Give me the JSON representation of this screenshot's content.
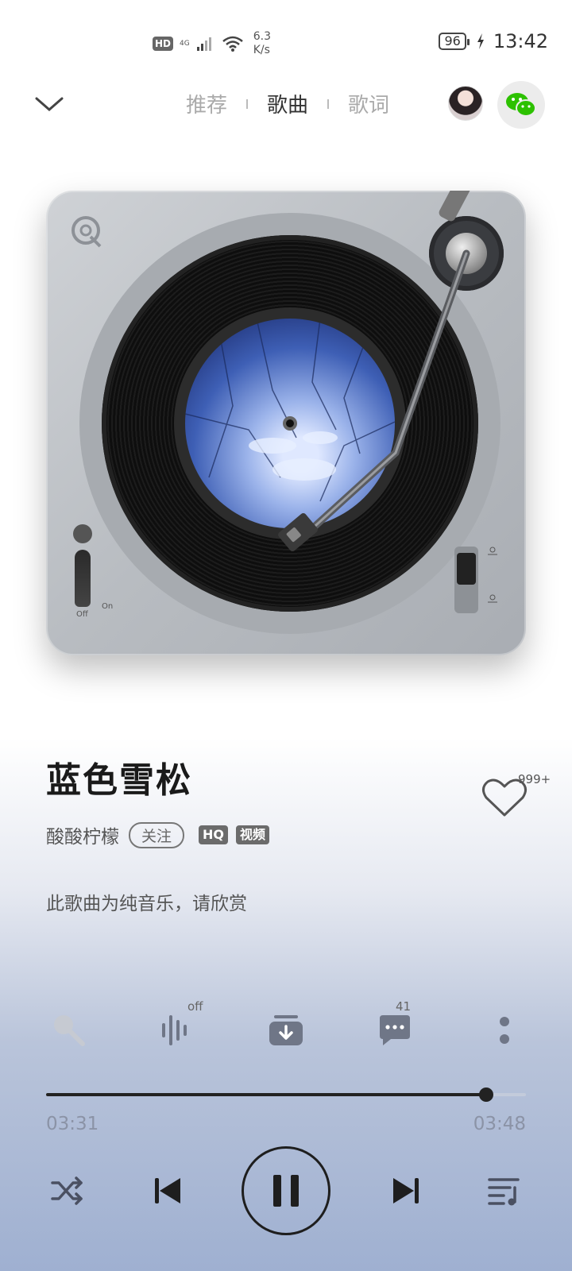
{
  "status_bar": {
    "hd_label": "HD",
    "network": "4G",
    "speed_value": "6.3",
    "speed_unit": "K/s",
    "battery": "96",
    "time": "13:42"
  },
  "nav": {
    "tabs": [
      {
        "label": "推荐",
        "active": false
      },
      {
        "label": "歌曲",
        "active": true
      },
      {
        "label": "歌词",
        "active": false
      }
    ]
  },
  "turntable": {
    "off_label": "Off",
    "on_label": "On"
  },
  "song": {
    "title": "蓝色雪松",
    "artist": "酸酸柠檬",
    "follow_label": "关注",
    "tags": [
      "HQ",
      "视频"
    ],
    "like_count": "999+",
    "lyrics_note": "此歌曲为纯音乐，请欣赏"
  },
  "actions": {
    "effect_badge": "off",
    "comment_count": "41"
  },
  "player": {
    "current_time": "03:31",
    "total_time": "03:48",
    "progress": 0.917
  },
  "icons": {
    "back": "chevron-down-icon",
    "share": "wechat-icon",
    "like": "heart-icon",
    "sing": "microphone-icon",
    "effect": "sound-effect-icon",
    "download": "download-icon",
    "comment": "comment-icon",
    "more": "more-icon",
    "shuffle": "shuffle-icon",
    "prev": "previous-icon",
    "pause": "pause-icon",
    "next": "next-icon",
    "playlist": "playlist-icon"
  },
  "colors": {
    "wechat_green": "#2dc100",
    "text_dark": "#1a1a1a",
    "time_text": "#8b93a6"
  }
}
